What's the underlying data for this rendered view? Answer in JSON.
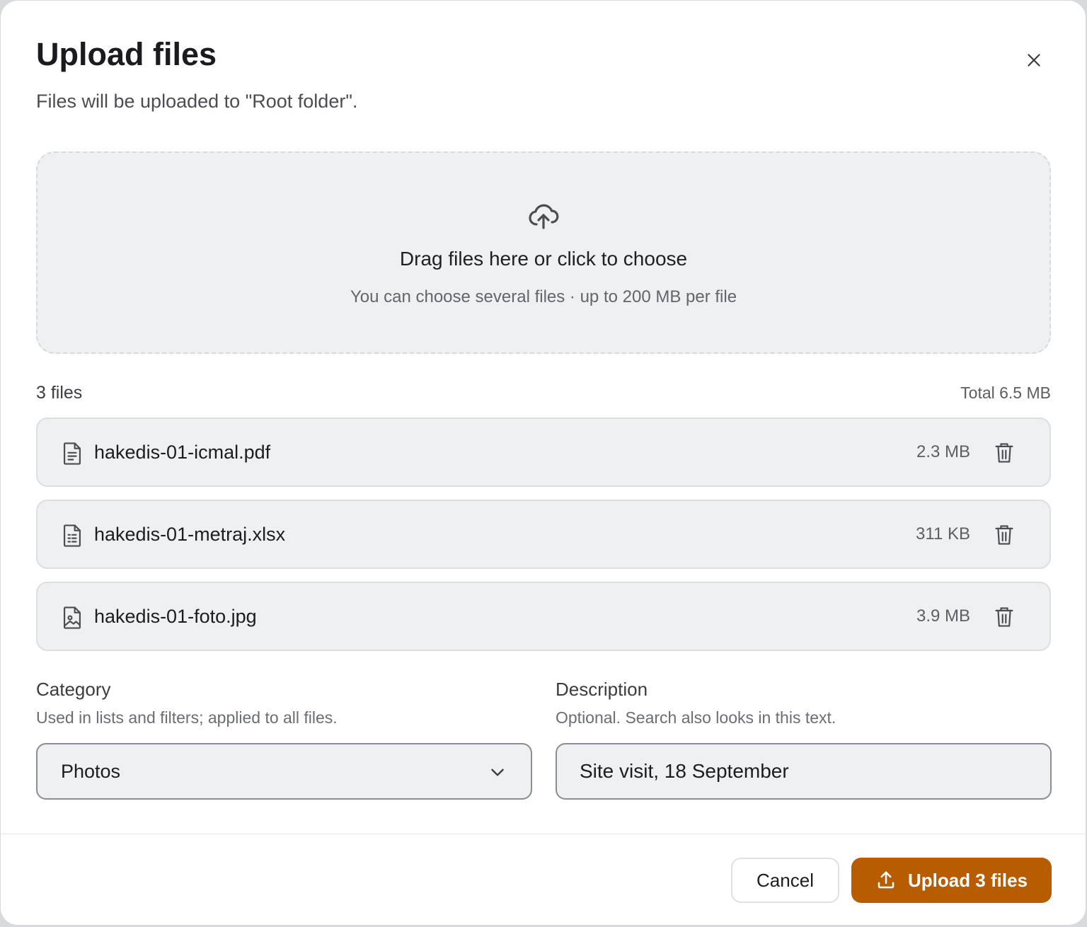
{
  "dialog": {
    "title": "Upload files",
    "subtitle": "Files will be uploaded to \"Root folder\".",
    "close_icon": "close-icon"
  },
  "dropzone": {
    "icon": "cloud-upload-icon",
    "title": "Drag files here or click to choose",
    "hint": "You can choose several files · up to 200 MB per file"
  },
  "files": {
    "count_label": "3 files",
    "total_label": "Total 6.5 MB",
    "items": [
      {
        "name": "hakedis-01-icmal.pdf",
        "size": "2.3 MB",
        "icon": "file-text-icon"
      },
      {
        "name": "hakedis-01-metraj.xlsx",
        "size": "311 KB",
        "icon": "file-spreadsheet-icon"
      },
      {
        "name": "hakedis-01-foto.jpg",
        "size": "3.9 MB",
        "icon": "file-image-icon"
      }
    ]
  },
  "category": {
    "label": "Category",
    "help": "Used in lists and filters; applied to all files.",
    "value": "Photos"
  },
  "description": {
    "label": "Description",
    "help": "Optional. Search also looks in this text.",
    "value": "Site visit, 18 September",
    "placeholder": ""
  },
  "footer": {
    "cancel_label": "Cancel",
    "upload_label": "Upload 3 files"
  },
  "colors": {
    "accent": "#b85c00",
    "surface": "#eff0f2",
    "border": "#dcdee2"
  }
}
